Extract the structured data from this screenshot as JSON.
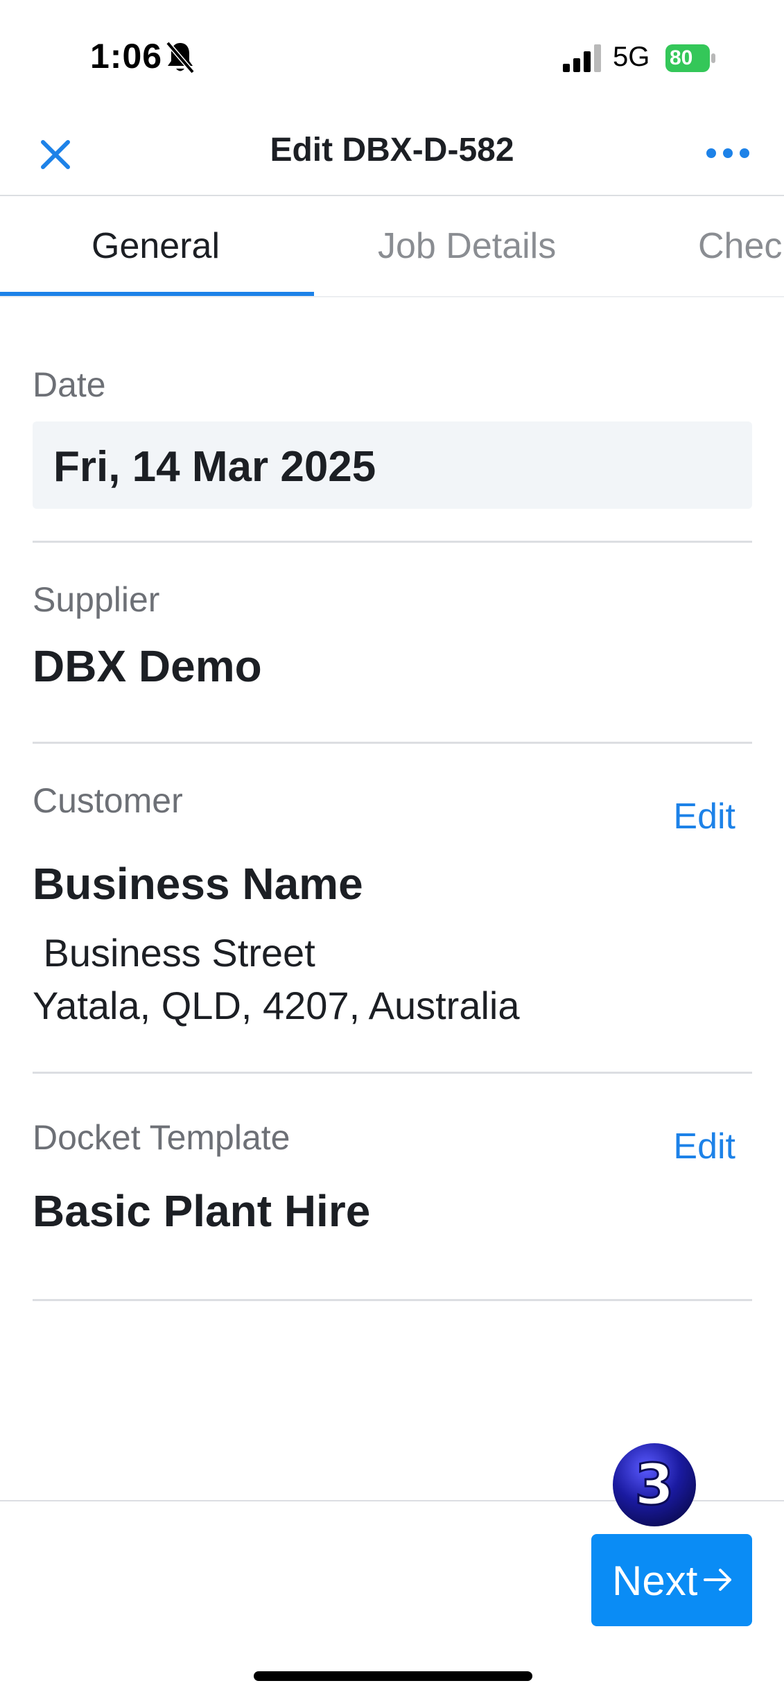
{
  "status_bar": {
    "time": "1:06",
    "network": "5G",
    "battery": "80"
  },
  "header": {
    "title": "Edit DBX-D-582",
    "close_icon": "close-icon",
    "more_icon": "more-horizontal-icon"
  },
  "tabs": [
    {
      "label": "General",
      "active": true
    },
    {
      "label": "Job Details",
      "active": false
    },
    {
      "label": "Chec",
      "active": false
    }
  ],
  "date": {
    "label": "Date",
    "value": "Fri, 14 Mar 2025"
  },
  "supplier": {
    "label": "Supplier",
    "value": "DBX Demo"
  },
  "customer": {
    "label": "Customer",
    "edit_label": "Edit",
    "name": "Business Name",
    "address_line1": " Business Street",
    "address_line2": "Yatala, QLD, 4207, Australia"
  },
  "docket_template": {
    "label": "Docket Template",
    "edit_label": "Edit",
    "value": "Basic Plant Hire"
  },
  "footer": {
    "next_label": "Next",
    "step_badge": "3"
  },
  "colors": {
    "accent": "#1d82e8",
    "button": "#0a8cf5",
    "battery": "#34c759",
    "badge": "#1a1a8c"
  }
}
